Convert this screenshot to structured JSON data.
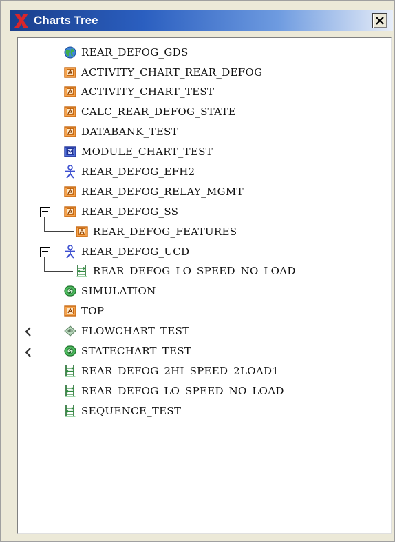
{
  "window": {
    "title": "Charts Tree",
    "close_glyph": "×"
  },
  "tree": {
    "items": [
      {
        "label": "REAR_DEFOG_GDS",
        "icon": "globe-icon"
      },
      {
        "label": "ACTIVITY_CHART_REAR_DEFOG",
        "icon": "activity-chart-icon"
      },
      {
        "label": "ACTIVITY_CHART_TEST",
        "icon": "activity-chart-icon"
      },
      {
        "label": "CALC_REAR_DEFOG_STATE",
        "icon": "activity-chart-icon"
      },
      {
        "label": "DATABANK_TEST",
        "icon": "activity-chart-icon"
      },
      {
        "label": "MODULE_CHART_TEST",
        "icon": "module-chart-icon"
      },
      {
        "label": "REAR_DEFOG_EFH2",
        "icon": "use-case-actor-icon"
      },
      {
        "label": "REAR_DEFOG_RELAY_MGMT",
        "icon": "activity-chart-icon"
      },
      {
        "label": "REAR_DEFOG_SS",
        "icon": "activity-chart-icon"
      },
      {
        "label": "REAR_DEFOG_FEATURES",
        "icon": "activity-chart-icon"
      },
      {
        "label": "REAR_DEFOG_UCD",
        "icon": "use-case-actor-icon"
      },
      {
        "label": "REAR_DEFOG_LO_SPEED_NO_LOAD",
        "icon": "sequence-diagram-icon"
      },
      {
        "label": "SIMULATION",
        "icon": "statechart-icon"
      },
      {
        "label": "TOP",
        "icon": "activity-chart-icon"
      },
      {
        "label": "FLOWCHART_TEST",
        "icon": "flowchart-icon"
      },
      {
        "label": "STATECHART_TEST",
        "icon": "statechart-icon"
      },
      {
        "label": "REAR_DEFOG_2HI_SPEED_2LOAD1",
        "icon": "sequence-diagram-icon"
      },
      {
        "label": "REAR_DEFOG_LO_SPEED_NO_LOAD",
        "icon": "sequence-diagram-icon"
      },
      {
        "label": "SEQUENCE_TEST",
        "icon": "sequence-diagram-icon"
      }
    ]
  },
  "colors": {
    "activity_orange": "#f4a24c",
    "module_blue": "#4f6fd8",
    "statechart_green": "#4cbb5e",
    "actor_blue": "#3c4fd0",
    "sequence_green": "#2e8b3e"
  }
}
